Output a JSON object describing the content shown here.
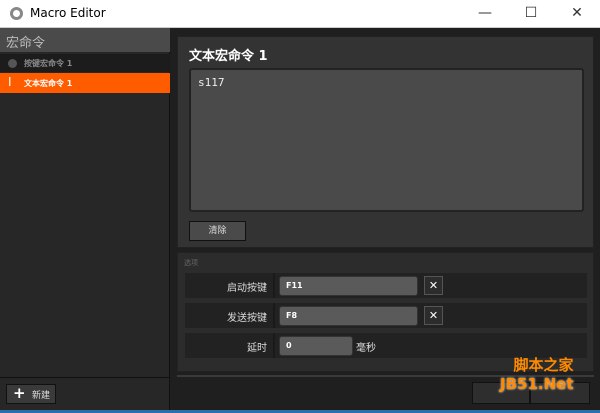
{
  "window": {
    "title": "Macro Editor",
    "minimize": "—",
    "maximize": "☐",
    "close": "✕"
  },
  "sidebar": {
    "header": "宏命令",
    "items": [
      {
        "label": "按键宏命令 1",
        "selected": false
      },
      {
        "label": "文本宏命令 1",
        "selected": true
      }
    ],
    "new_button": "新建"
  },
  "editor": {
    "title": "文本宏命令 1",
    "text": "s117",
    "clear_button": "清除"
  },
  "options": {
    "section_label": "选项",
    "start_key": {
      "label": "启动按键",
      "value": "F11"
    },
    "send_key": {
      "label": "发送按键",
      "value": "F8"
    },
    "delay": {
      "label": "延时",
      "value": "0",
      "unit": "毫秒"
    }
  },
  "footer": {
    "ok_button": "",
    "cancel_button": ""
  },
  "watermark": {
    "line1": "脚本之家",
    "line2": "JB51.Net"
  },
  "colors": {
    "accent": "#ff5c00"
  }
}
